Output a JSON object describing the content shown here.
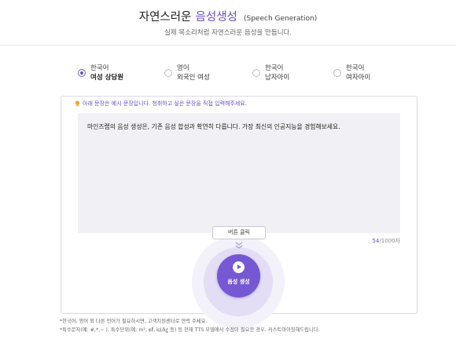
{
  "header": {
    "title_main": "자연스러운",
    "title_accent": "음성생성",
    "title_en": "(Speech Generation)",
    "subtitle": "실제 목소리처럼 자연스러운 음성을 만듭니다."
  },
  "voices": [
    {
      "lang": "한국어",
      "name": "여성 상담원",
      "selected": true
    },
    {
      "lang": "영어",
      "name": "외국인 여성",
      "selected": false
    },
    {
      "lang": "한국어",
      "name": "남자아이",
      "selected": false
    },
    {
      "lang": "한국어",
      "name": "여자아이",
      "selected": false
    }
  ],
  "editor": {
    "hint": "아래 문장은 예시 문장입니다. 청취하고 싶은 문장을 직접 입력해주세요.",
    "text": "마인즈랩의 음성 생성은, 기존 음성 합성과 확연히 다릅니다. 가장 최신의 인공지능을 경험해보세요.",
    "count": "54",
    "limit": "/1000자"
  },
  "generate": {
    "tooltip": "버튼 클릭",
    "label": "음성 생성"
  },
  "notes": {
    "line1": "*한국어, 영어 외 다른 언어가 필요하시면, 고객지원센터로 연락 주세요.",
    "line2": "*특수문자(예: #,*,~ ), 특수단위(예: m², ㎖, ㎉/㎏ 등) 등 현재 TTS 모델에서 수정이 필요한 경우, 커스트마이징해드립니다."
  },
  "colors": {
    "accent": "#6b50c8",
    "button": "#7558d2"
  }
}
